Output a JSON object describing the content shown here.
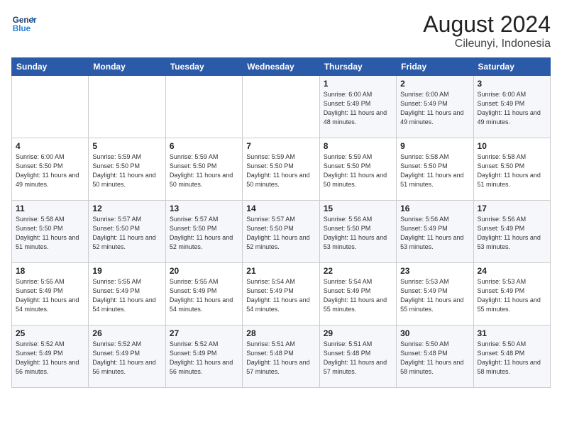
{
  "header": {
    "logo_line1": "General",
    "logo_line2": "Blue",
    "title": "August 2024",
    "subtitle": "Cileunyi, Indonesia"
  },
  "weekdays": [
    "Sunday",
    "Monday",
    "Tuesday",
    "Wednesday",
    "Thursday",
    "Friday",
    "Saturday"
  ],
  "weeks": [
    [
      {
        "day": "",
        "info": ""
      },
      {
        "day": "",
        "info": ""
      },
      {
        "day": "",
        "info": ""
      },
      {
        "day": "",
        "info": ""
      },
      {
        "day": "1",
        "info": "Sunrise: 6:00 AM\nSunset: 5:49 PM\nDaylight: 11 hours\nand 48 minutes."
      },
      {
        "day": "2",
        "info": "Sunrise: 6:00 AM\nSunset: 5:49 PM\nDaylight: 11 hours\nand 49 minutes."
      },
      {
        "day": "3",
        "info": "Sunrise: 6:00 AM\nSunset: 5:49 PM\nDaylight: 11 hours\nand 49 minutes."
      }
    ],
    [
      {
        "day": "4",
        "info": "Sunrise: 6:00 AM\nSunset: 5:50 PM\nDaylight: 11 hours\nand 49 minutes."
      },
      {
        "day": "5",
        "info": "Sunrise: 5:59 AM\nSunset: 5:50 PM\nDaylight: 11 hours\nand 50 minutes."
      },
      {
        "day": "6",
        "info": "Sunrise: 5:59 AM\nSunset: 5:50 PM\nDaylight: 11 hours\nand 50 minutes."
      },
      {
        "day": "7",
        "info": "Sunrise: 5:59 AM\nSunset: 5:50 PM\nDaylight: 11 hours\nand 50 minutes."
      },
      {
        "day": "8",
        "info": "Sunrise: 5:59 AM\nSunset: 5:50 PM\nDaylight: 11 hours\nand 50 minutes."
      },
      {
        "day": "9",
        "info": "Sunrise: 5:58 AM\nSunset: 5:50 PM\nDaylight: 11 hours\nand 51 minutes."
      },
      {
        "day": "10",
        "info": "Sunrise: 5:58 AM\nSunset: 5:50 PM\nDaylight: 11 hours\nand 51 minutes."
      }
    ],
    [
      {
        "day": "11",
        "info": "Sunrise: 5:58 AM\nSunset: 5:50 PM\nDaylight: 11 hours\nand 51 minutes."
      },
      {
        "day": "12",
        "info": "Sunrise: 5:57 AM\nSunset: 5:50 PM\nDaylight: 11 hours\nand 52 minutes."
      },
      {
        "day": "13",
        "info": "Sunrise: 5:57 AM\nSunset: 5:50 PM\nDaylight: 11 hours\nand 52 minutes."
      },
      {
        "day": "14",
        "info": "Sunrise: 5:57 AM\nSunset: 5:50 PM\nDaylight: 11 hours\nand 52 minutes."
      },
      {
        "day": "15",
        "info": "Sunrise: 5:56 AM\nSunset: 5:50 PM\nDaylight: 11 hours\nand 53 minutes."
      },
      {
        "day": "16",
        "info": "Sunrise: 5:56 AM\nSunset: 5:49 PM\nDaylight: 11 hours\nand 53 minutes."
      },
      {
        "day": "17",
        "info": "Sunrise: 5:56 AM\nSunset: 5:49 PM\nDaylight: 11 hours\nand 53 minutes."
      }
    ],
    [
      {
        "day": "18",
        "info": "Sunrise: 5:55 AM\nSunset: 5:49 PM\nDaylight: 11 hours\nand 54 minutes."
      },
      {
        "day": "19",
        "info": "Sunrise: 5:55 AM\nSunset: 5:49 PM\nDaylight: 11 hours\nand 54 minutes."
      },
      {
        "day": "20",
        "info": "Sunrise: 5:55 AM\nSunset: 5:49 PM\nDaylight: 11 hours\nand 54 minutes."
      },
      {
        "day": "21",
        "info": "Sunrise: 5:54 AM\nSunset: 5:49 PM\nDaylight: 11 hours\nand 54 minutes."
      },
      {
        "day": "22",
        "info": "Sunrise: 5:54 AM\nSunset: 5:49 PM\nDaylight: 11 hours\nand 55 minutes."
      },
      {
        "day": "23",
        "info": "Sunrise: 5:53 AM\nSunset: 5:49 PM\nDaylight: 11 hours\nand 55 minutes."
      },
      {
        "day": "24",
        "info": "Sunrise: 5:53 AM\nSunset: 5:49 PM\nDaylight: 11 hours\nand 55 minutes."
      }
    ],
    [
      {
        "day": "25",
        "info": "Sunrise: 5:52 AM\nSunset: 5:49 PM\nDaylight: 11 hours\nand 56 minutes."
      },
      {
        "day": "26",
        "info": "Sunrise: 5:52 AM\nSunset: 5:49 PM\nDaylight: 11 hours\nand 56 minutes."
      },
      {
        "day": "27",
        "info": "Sunrise: 5:52 AM\nSunset: 5:49 PM\nDaylight: 11 hours\nand 56 minutes."
      },
      {
        "day": "28",
        "info": "Sunrise: 5:51 AM\nSunset: 5:48 PM\nDaylight: 11 hours\nand 57 minutes."
      },
      {
        "day": "29",
        "info": "Sunrise: 5:51 AM\nSunset: 5:48 PM\nDaylight: 11 hours\nand 57 minutes."
      },
      {
        "day": "30",
        "info": "Sunrise: 5:50 AM\nSunset: 5:48 PM\nDaylight: 11 hours\nand 58 minutes."
      },
      {
        "day": "31",
        "info": "Sunrise: 5:50 AM\nSunset: 5:48 PM\nDaylight: 11 hours\nand 58 minutes."
      }
    ]
  ]
}
